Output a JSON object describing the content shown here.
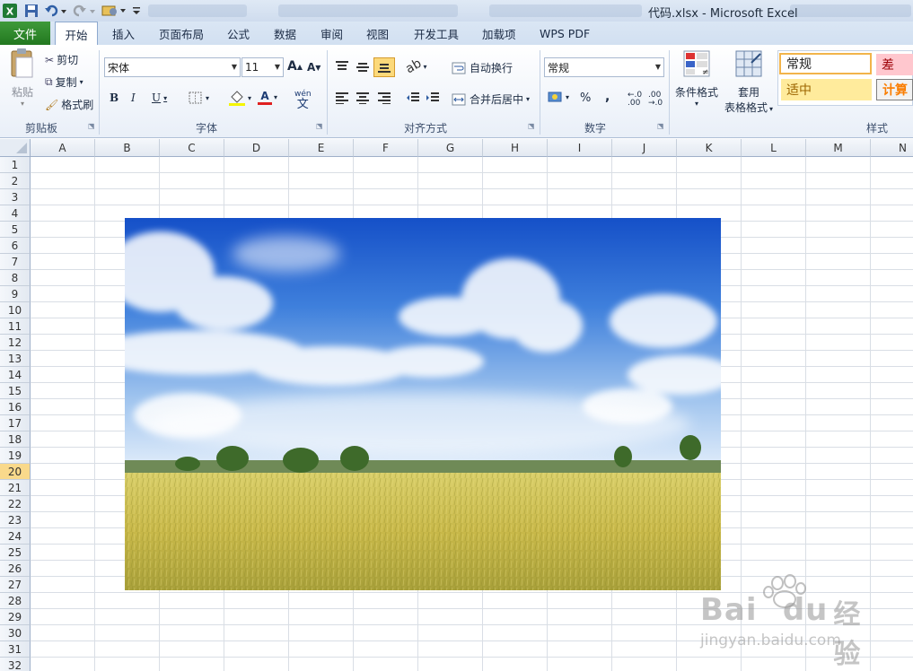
{
  "window": {
    "title": "代码.xlsx - Microsoft Excel",
    "app_icon": "excel-icon"
  },
  "tabs": [
    {
      "label": "文件",
      "file": true
    },
    {
      "label": "开始",
      "active": true
    },
    {
      "label": "插入"
    },
    {
      "label": "页面布局"
    },
    {
      "label": "公式"
    },
    {
      "label": "数据"
    },
    {
      "label": "审阅"
    },
    {
      "label": "视图"
    },
    {
      "label": "开发工具"
    },
    {
      "label": "加载项"
    },
    {
      "label": "WPS PDF"
    }
  ],
  "ribbon": {
    "clipboard": {
      "paste": "粘贴",
      "cut": "剪切",
      "copy": "复制",
      "format_painter": "格式刷",
      "label": "剪贴板"
    },
    "font": {
      "name": "宋体",
      "size": "11",
      "label": "字体",
      "bold": "B",
      "italic": "I",
      "underline": "U",
      "grow": "A",
      "shrink": "A",
      "font_color": "A",
      "phonetic": "wén"
    },
    "alignment": {
      "wrap": "自动换行",
      "merge": "合并后居中",
      "label": "对齐方式"
    },
    "number": {
      "format": "常规",
      "percent": "%",
      "comma": ",",
      "label": "数字"
    },
    "styles": {
      "conditional": "条件格式",
      "table_line1": "套用",
      "table_line2": "表格格式",
      "normal": "常规",
      "bad": "差",
      "neutral": "适中",
      "calc": "计算",
      "label": "样式"
    }
  },
  "sheet": {
    "columns": [
      "A",
      "B",
      "C",
      "D",
      "E",
      "F",
      "G",
      "H",
      "I",
      "J",
      "K",
      "L",
      "M",
      "N"
    ],
    "rows": [
      "1",
      "2",
      "3",
      "4",
      "5",
      "6",
      "7",
      "8",
      "9",
      "10",
      "11",
      "12",
      "13",
      "14",
      "15",
      "16",
      "17",
      "18",
      "19",
      "20",
      "21",
      "22",
      "23",
      "24",
      "25",
      "26",
      "27",
      "28",
      "29",
      "30",
      "31",
      "32"
    ],
    "selected_row": "20"
  },
  "picture": {
    "subject": "sky-clouds-wheat-field-photo"
  },
  "watermark": {
    "brand_left": "Bai",
    "brand_right": "du",
    "brand_cn": "经验",
    "url": "jingyan.baidu.com"
  },
  "colors": {
    "file_tab": "#2e8b2a",
    "selected_row": "#f9d98b",
    "bad_style": "#ffc7ce",
    "neutral_style": "#ffeb9c"
  }
}
